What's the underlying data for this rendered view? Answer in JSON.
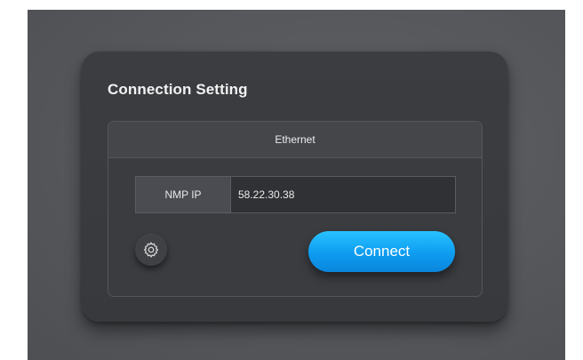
{
  "dialog": {
    "title": "Connection Setting",
    "panel": {
      "header": "Ethernet",
      "ip_field": {
        "label": "NMP IP",
        "value": "58.22.30.38"
      },
      "settings_icon": "gear-icon",
      "connect_label": "Connect"
    }
  },
  "colors": {
    "background": "#55575b",
    "dialog": "#3a3c40",
    "accent": "#0d9cf0"
  }
}
